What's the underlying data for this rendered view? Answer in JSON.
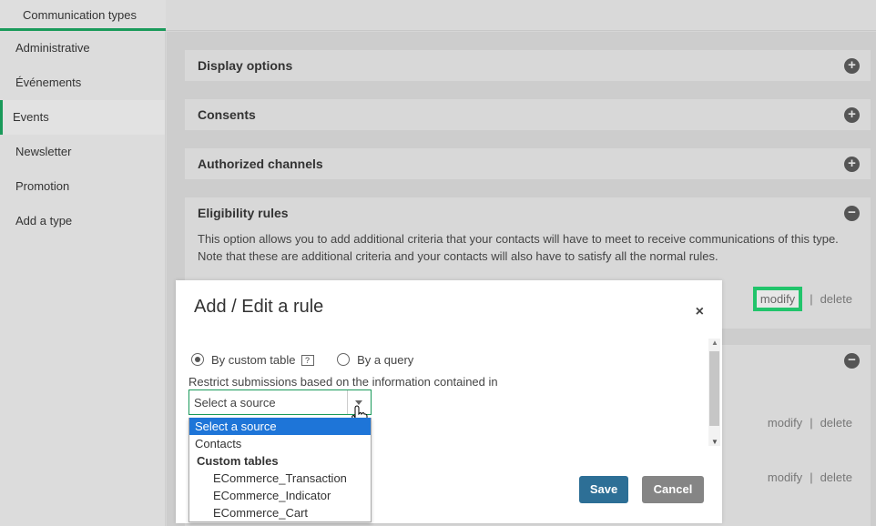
{
  "top_tab": {
    "label": "Communication types"
  },
  "sidebar": {
    "items": [
      {
        "label": "Administrative"
      },
      {
        "label": "Événements"
      },
      {
        "label": "Events"
      },
      {
        "label": "Newsletter"
      },
      {
        "label": "Promotion"
      },
      {
        "label": "Add a type"
      }
    ],
    "active": "Events"
  },
  "panels": {
    "display": {
      "title": "Display options"
    },
    "consents": {
      "title": "Consents"
    },
    "channels": {
      "title": "Authorized channels"
    },
    "eligibility": {
      "title": "Eligibility rules",
      "description": "This option allows you to add additional criteria that your contacts will have to meet to receive communications of this type. Note that these are additional criteria and your contacts will also have to satisfy all the normal rules.",
      "modify": "modify",
      "separator": "|",
      "delete": "delete"
    },
    "row2": {
      "modify": "modify",
      "separator": "|",
      "delete": "delete"
    },
    "row3": {
      "modify": "modify",
      "separator": "|",
      "delete": "delete"
    }
  },
  "icons": {
    "plus": "+",
    "minus": "−",
    "close": "×",
    "help": "?"
  },
  "modal": {
    "title": "Add / Edit a rule",
    "radio_custom_table": "By custom table",
    "radio_query": "By a query",
    "restrict_text": "Restrict submissions based on the information contained in",
    "select_value": "Select a source",
    "dropdown": {
      "selected": "Select a source",
      "contacts": "Contacts",
      "group_label": "Custom tables",
      "options": [
        "ECommerce_Transaction",
        "ECommerce_Indicator",
        "ECommerce_Cart"
      ]
    },
    "save": "Save",
    "cancel": "Cancel"
  },
  "colors": {
    "accent": "#1a9a5a",
    "highlight": "#21c46b",
    "save": "#2d6f96",
    "cancel": "#858585",
    "selected": "#1e75d8"
  }
}
